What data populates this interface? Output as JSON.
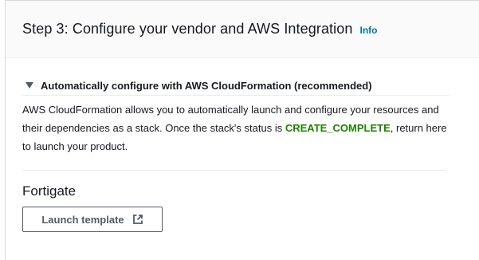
{
  "header": {
    "title": "Step 3: Configure your vendor and AWS Integration",
    "info_label": "Info"
  },
  "expander": {
    "label": "Automatically configure with AWS CloudFormation (recommended)",
    "expanded": true
  },
  "description": {
    "text_before": "AWS CloudFormation allows you to automatically launch and configure your resources and their dependencies as a stack. Once the stack's status is ",
    "status_code": "CREATE_COMPLETE",
    "text_after": ", return here to launch your product."
  },
  "product": {
    "name": "Fortigate",
    "launch_button_label": "Launch template",
    "launch_button_icon": "external-link-icon"
  },
  "colors": {
    "info_link": "#0073bb",
    "status_code": "#1d8102",
    "button_border": "#545b64",
    "header_background": "#fafafa"
  }
}
